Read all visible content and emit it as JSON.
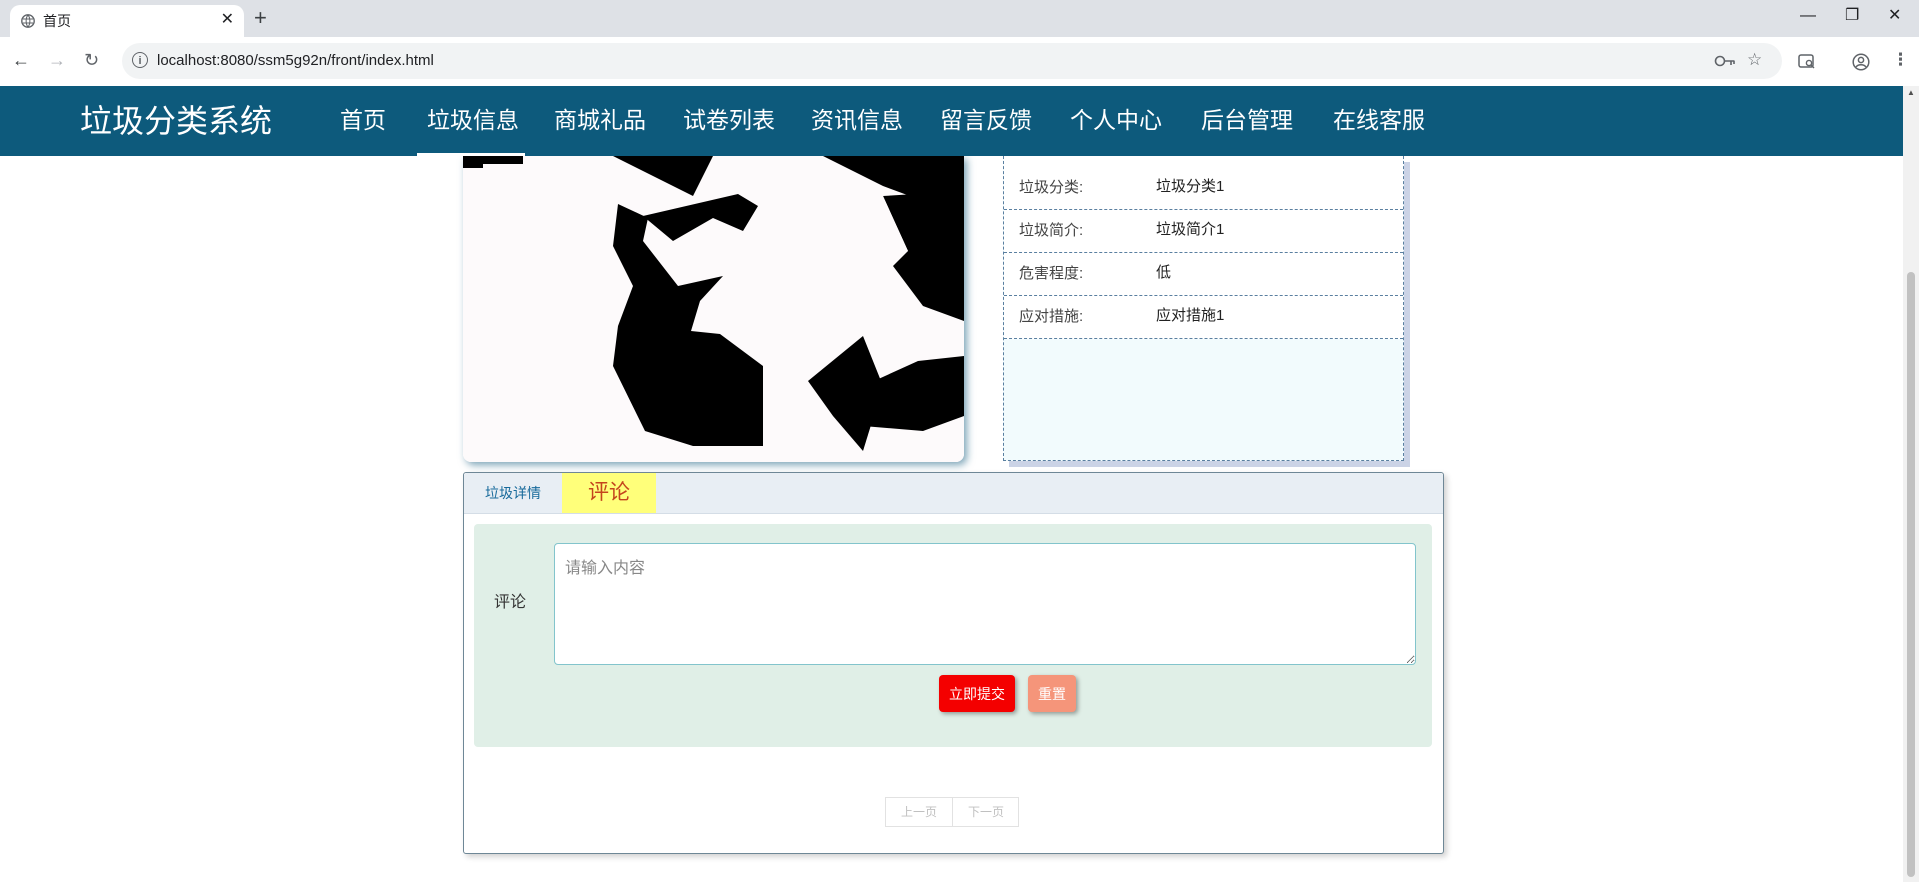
{
  "browser": {
    "tab_title": "首页",
    "tab_close": "✕",
    "new_tab": "+",
    "url": "localhost:8080/ssm5g92n/front/index.html",
    "window_minimize": "—",
    "window_restore": "❐",
    "window_close": "✕"
  },
  "header": {
    "site_title": "垃圾分类系统",
    "active_nav_index": 1,
    "nav_items": [
      "首页",
      "垃圾信息",
      "商城礼品",
      "试卷列表",
      "资讯信息",
      "留言反馈",
      "个人中心",
      "后台管理",
      "在线客服"
    ]
  },
  "info": {
    "rows": [
      {
        "label": "垃圾分类:",
        "value": "垃圾分类1"
      },
      {
        "label": "垃圾简介:",
        "value": "垃圾简介1"
      },
      {
        "label": "危害程度:",
        "value": "低"
      },
      {
        "label": "应对措施:",
        "value": "应对措施1"
      }
    ]
  },
  "tabs": {
    "detail": "垃圾详情",
    "comment": "评论"
  },
  "comment_form": {
    "label": "评论",
    "placeholder": "请输入内容",
    "value": "",
    "submit_label": "立即提交",
    "reset_label": "重置"
  },
  "pagination": {
    "prev": "上一页",
    "next": "下一页"
  },
  "colors": {
    "header_bg": "#0d5a7c",
    "submit_bg": "#f40000",
    "reset_bg": "#f5957a",
    "active_tab_bg": "#ffff7a",
    "comment_panel_bg": "#e0efe7"
  }
}
